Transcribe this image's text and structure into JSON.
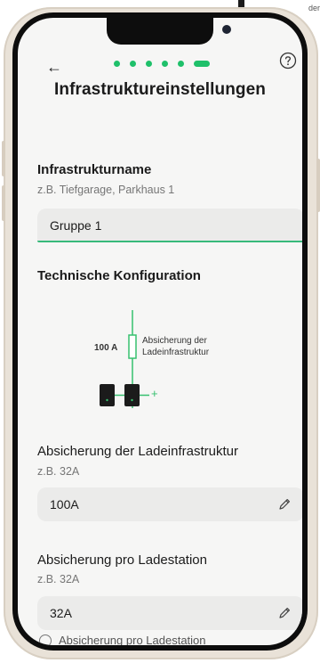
{
  "corner_text": "der",
  "header": {
    "title": "Infrastruktureinstellungen",
    "back_glyph": "←",
    "help_icon": "help-circle-icon",
    "accent": "#1fc06a"
  },
  "infrastructure": {
    "title": "Infrastrukturname",
    "hint": "z.B. Tiefgarage, Parkhaus 1",
    "value": "Gruppe 1"
  },
  "technical": {
    "title": "Technische Konfiguration",
    "diagram": {
      "amp_label": "100 A",
      "fuse_label_1": "Absicherung der",
      "fuse_label_2": "Ladeinfrastruktur",
      "plus": "+"
    }
  },
  "fields": {
    "infra_fuse": {
      "label": "Absicherung der Ladeinfrastruktur",
      "hint": "z.B. 32A",
      "value": "100A"
    },
    "station_fuse": {
      "label": "Absicherung pro Ladestation",
      "hint": "z.B. 32A",
      "value": "32A"
    }
  },
  "checkbox": {
    "label": "Absicherung pro Ladestation"
  }
}
